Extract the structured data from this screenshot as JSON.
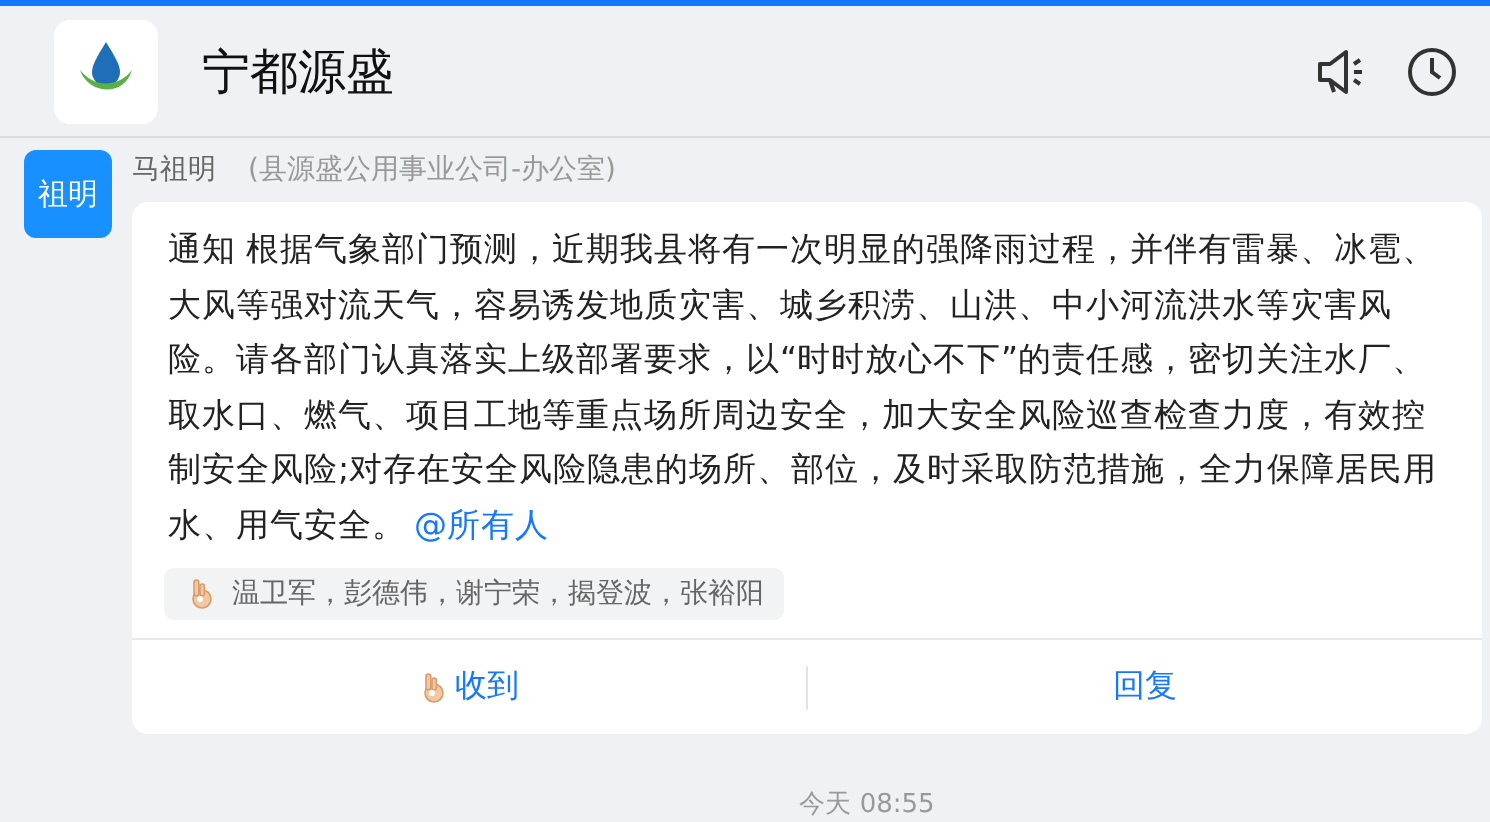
{
  "header": {
    "title": "宁都源盛"
  },
  "message": {
    "avatar": "祖明",
    "sender": "马祖明",
    "department": "(县源盛公用事业公司-办公室)",
    "body": "通知  根据气象部门预测，近期我县将有一次明显的强降雨过程，并伴有雷暴、冰雹、大风等强对流天气，容易诱发地质灾害、城乡积涝、山洪、中小河流洪水等灾害风险。请各部门认真落实上级部署要求，以“时时放心不下”的责任感，密切关注水厂、取水口、燃气、项目工地等重点场所周边安全，加大安全风险巡查检查力度，有效控制安全风险;对存在安全风险隐患的场所、部位，及时采取防范措施，全力保障居民用水、用气安全。",
    "mention": "@所有人",
    "acknowledged_by": "温卫军，彭德伟，谢宁荣，揭登波，张裕阳",
    "actions": [
      {
        "kind": "acknowledge",
        "label": "收到"
      },
      {
        "kind": "reply",
        "label": "回复"
      }
    ]
  },
  "timestamp": "今天 08:55"
}
